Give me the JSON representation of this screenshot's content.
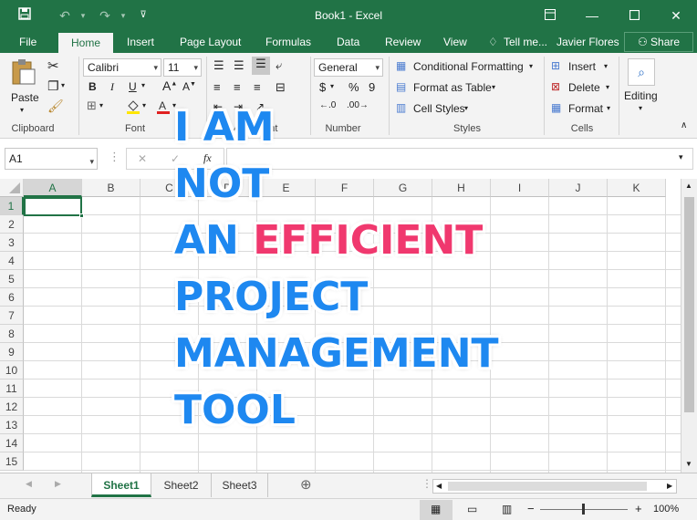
{
  "window": {
    "title": "Book1 - Excel",
    "user": "Javier Flores",
    "share_label": "Share"
  },
  "menu": {
    "file": "File",
    "tabs": [
      "Home",
      "Insert",
      "Page Layout",
      "Formulas",
      "Data",
      "Review",
      "View"
    ],
    "tell": "Tell me..."
  },
  "ribbon": {
    "clipboard": {
      "label": "Clipboard",
      "paste": "Paste"
    },
    "font": {
      "label": "Font",
      "name": "Calibri",
      "size": "11",
      "bold": "B",
      "italic": "I",
      "underline": "U"
    },
    "alignment": {
      "label": "Alignment"
    },
    "number": {
      "label": "Number",
      "format": "General",
      "currency": "$",
      "percent": "%",
      "comma": "9"
    },
    "styles": {
      "label": "Styles",
      "conditional": "Conditional Formatting",
      "table": "Format as Table",
      "cell": "Cell Styles"
    },
    "cells": {
      "label": "Cells",
      "insert": "Insert",
      "delete": "Delete",
      "format": "Format"
    },
    "editing": {
      "label": "Editing"
    }
  },
  "formula_bar": {
    "name_box": "A1",
    "fx": "fx",
    "cancel": "✕",
    "enter": "✓",
    "value": ""
  },
  "grid": {
    "columns": [
      "A",
      "B",
      "C",
      "D",
      "E",
      "F",
      "G",
      "H",
      "I",
      "J",
      "K"
    ],
    "rows": [
      "1",
      "2",
      "3",
      "4",
      "5",
      "6",
      "7",
      "8",
      "9",
      "10",
      "11",
      "12",
      "13",
      "14",
      "15"
    ]
  },
  "sheets": {
    "tabs": [
      "Sheet1",
      "Sheet2",
      "Sheet3"
    ],
    "active": "Sheet1"
  },
  "status": {
    "ready": "Ready",
    "zoom": "100%"
  },
  "overlay": {
    "line1": "I AM",
    "line2": "NOT",
    "line3_a": "AN",
    "line3_b": "EFFICIENT",
    "line4": "PROJECT",
    "line5": "MANAGEMENT",
    "line6": "TOOL"
  },
  "colors": {
    "brand": "#217346",
    "overlay_blue": "#1e88f0",
    "overlay_pink": "#f0386e"
  }
}
